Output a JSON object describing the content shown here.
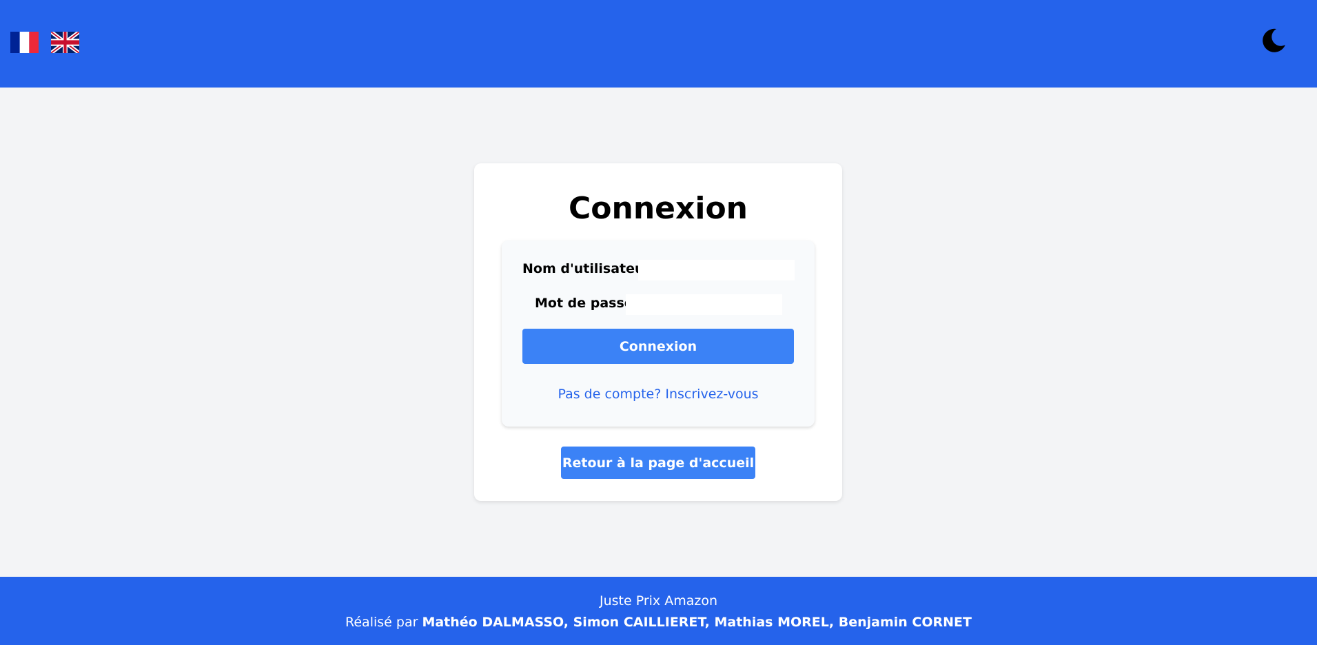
{
  "header": {
    "languages": [
      {
        "code": "fr",
        "icon": "french-flag-icon"
      },
      {
        "code": "en",
        "icon": "uk-flag-icon"
      }
    ],
    "theme_toggle_icon": "moon-icon",
    "background_color": "#2563eb"
  },
  "login": {
    "title": "Connexion",
    "username_label": "Nom d'utilisateur",
    "username_value": "",
    "password_label": "Mot de passe",
    "password_value": "",
    "submit_label": "Connexion",
    "signup_link": "Pas de compte? Inscrivez-vous",
    "home_button": "Retour à la page d'accueil"
  },
  "footer": {
    "title": "Juste Prix Amazon",
    "credits_prefix": "Réalisé par",
    "authors": [
      "Mathéo DALMASSO",
      "Simon CAILLIERET",
      "Mathias MOREL",
      "Benjamin CORNET"
    ]
  },
  "colors": {
    "accent": "#2563eb",
    "button": "#3b82f6",
    "page_background": "#f3f4f6"
  }
}
